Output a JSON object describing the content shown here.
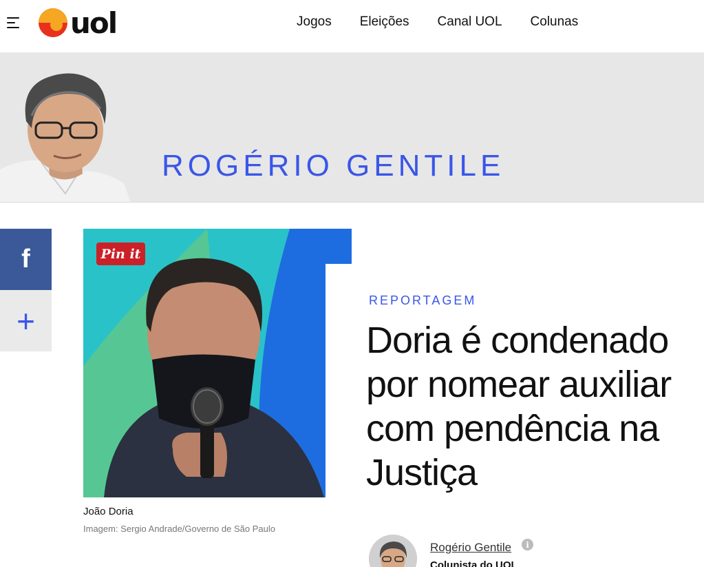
{
  "header": {
    "logo_text": "uol",
    "nav": [
      "Jogos",
      "Eleições",
      "Canal UOL",
      "Colunas"
    ]
  },
  "banner": {
    "author_title": "ROGÉRIO GENTILE"
  },
  "share": {
    "facebook_glyph": "f",
    "more_glyph": "+"
  },
  "photo": {
    "pin_label": "Pin it",
    "caption": "João Doria",
    "credit": "Imagem: Sergio Andrade/Governo de São Paulo"
  },
  "article": {
    "kicker": "REPORTAGEM",
    "headline": "Doria é condenado por nomear auxiliar com pendência na Justiça"
  },
  "byline": {
    "author": "Rogério Gentile",
    "info_glyph": "i",
    "role": "Colunista do UOL"
  },
  "colors": {
    "brand_blue": "#3a56e8",
    "facebook": "#3b5998",
    "pinterest": "#cb2027",
    "uol_orange": "#f5a623",
    "uol_red": "#e8301c"
  }
}
